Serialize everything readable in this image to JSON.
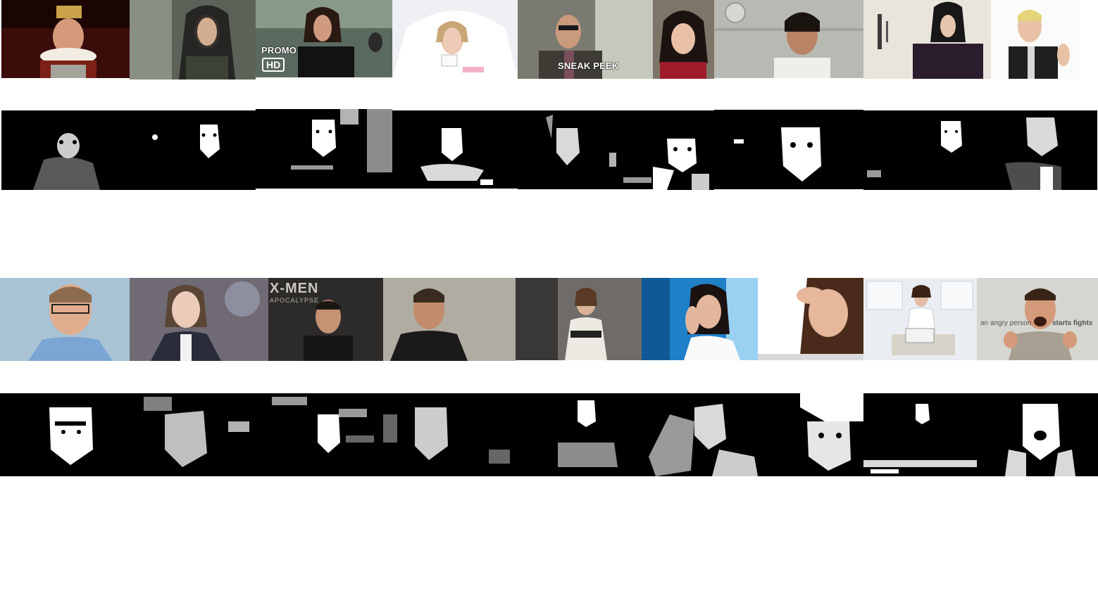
{
  "overlays": {
    "promo": "PROMO",
    "hd": "HD",
    "sneak_peek": "SNEAK PEEK",
    "xmen_title": "X-MEN",
    "xmen_sub": "APOCALYPSE",
    "angry_left": "an angry person",
    "angry_right": "starts fights"
  },
  "palette": {
    "photo_bg": "#6b6b6b",
    "mask_bg": "#000000",
    "mask_fg": "#ffffff"
  }
}
